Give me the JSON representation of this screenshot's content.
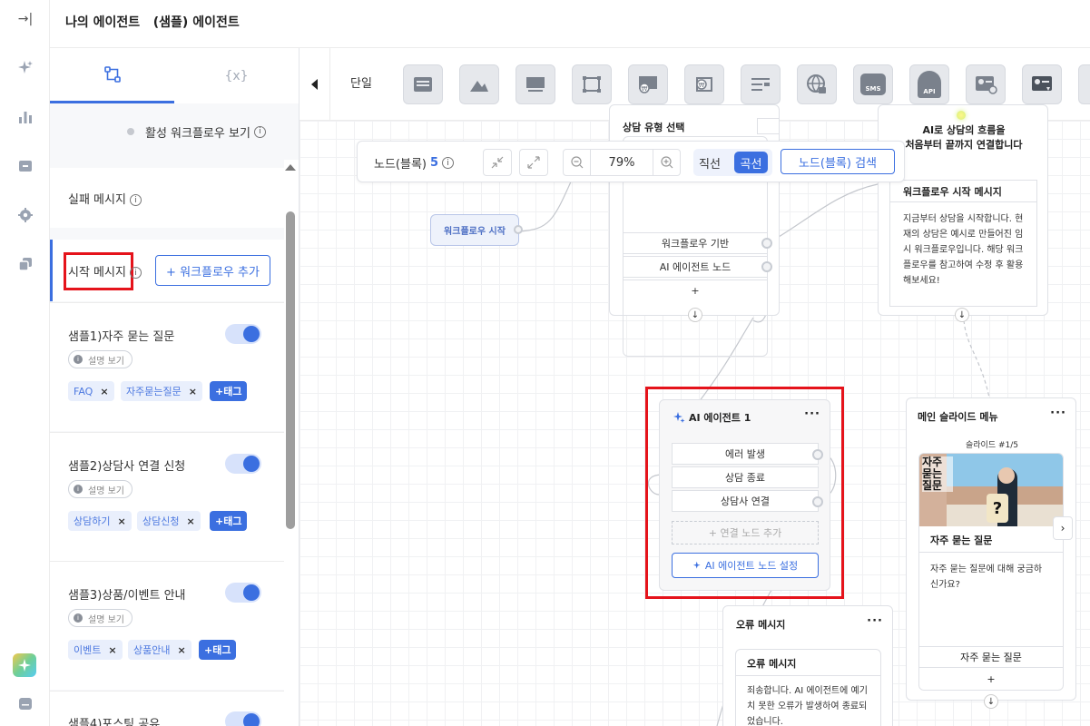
{
  "header": {
    "title": "나의 에이전트   (샘플) 에이전트"
  },
  "rail": {
    "collapse_icon": "→|"
  },
  "panel": {
    "tab_workflow_icon": "workflow-icon",
    "tab_variable_label": "{x}",
    "active_workflow_label": "활성 워크플로우 보기",
    "fail_message_label": "실패 메시지",
    "start_message_label": "시작 메시지",
    "add_workflow_label": "+ 워크플로우 추가",
    "desc_label": "설명 보기",
    "add_tag_label": "+태그",
    "workflows": [
      {
        "name": "샘플1)자주 묻는 질문",
        "tags": [
          "FAQ",
          "자주묻는질문"
        ]
      },
      {
        "name": "샘플2)상담사 연결 신청",
        "tags": [
          "상담하기",
          "상담신청"
        ]
      },
      {
        "name": "샘플3)상품/이벤트 안내",
        "tags": [
          "이벤트",
          "상품안내"
        ]
      },
      {
        "name": "샘플4)포스팅 공유",
        "tags": []
      }
    ]
  },
  "toolbar": {
    "mode_label": "단일",
    "sms_label": "SMS",
    "api_label": "API"
  },
  "controls": {
    "node_count_label": "노드(블록)",
    "node_count": "5",
    "zoom": "79%",
    "straight_label": "직선",
    "curve_label": "곡선",
    "search_label": "노드(블록) 검색"
  },
  "nodes": {
    "start": {
      "label": "워크플로우 시작"
    },
    "consult_type": {
      "title": "상담 유형 선택",
      "rows": [
        "워크플로우 기반",
        "AI 에이전트 노드",
        "+"
      ]
    },
    "intro": {
      "title_line1": "AI로 상담의 흐름을",
      "title_line2": "처음부터 끝까지 연결합니다",
      "subtitle": "워크플로우 시작 메시지",
      "body": "지금부터 상담을 시작합니다. 현재의 상담은 예시로 만들어진 임시 워크플로우입니다. 해당 워크플로우를 참고하여 수정 후 활용해보세요!"
    },
    "agent": {
      "title": "AI 에이전트 1",
      "rows": [
        "에러 발생",
        "상담 종료",
        "상담사 연결"
      ],
      "add_label": "+ 연결 노드 추가",
      "setup_label": "AI 에이전트 노드 설정"
    },
    "slide": {
      "title": "메인 슬라이드 메뉴",
      "counter": "슬라이드 #1/5",
      "image_text": "자주\n묻는\n질문",
      "card_title": "자주 묻는 질문",
      "card_body": "자주 묻는 질문에 대해 궁금하신가요?",
      "button": "자주 묻는 질문",
      "plus": "+"
    },
    "error": {
      "title": "오류 메시지",
      "inner_title": "오류 메시지",
      "body": "죄송합니다. AI 에이전트에 예기치 못한 오류가 발생하여 종료되었습니다."
    }
  },
  "colors": {
    "accent": "#3b6fe0",
    "highlight": "#e5131b"
  }
}
